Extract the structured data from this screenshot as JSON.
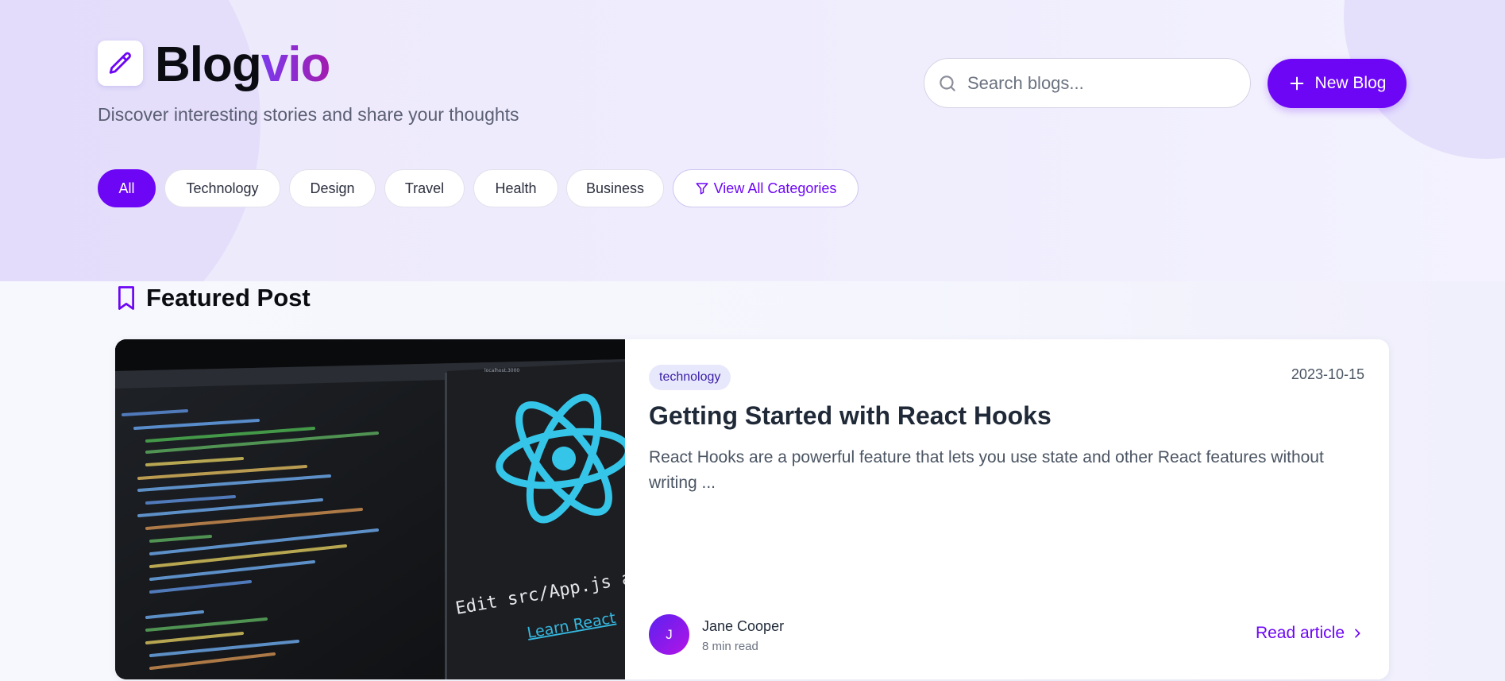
{
  "brand": {
    "name_part1": "Blog",
    "name_part2": "vio",
    "tagline": "Discover interesting stories and share your thoughts",
    "accent_color": "#6d06f5"
  },
  "header": {
    "search_placeholder": "Search blogs...",
    "new_blog_label": "New Blog"
  },
  "categories": {
    "items": [
      "All",
      "Technology",
      "Design",
      "Travel",
      "Health",
      "Business"
    ],
    "active": "All",
    "view_all_label": "View All Categories"
  },
  "featured": {
    "section_title": "Featured Post",
    "post": {
      "category": "technology",
      "date": "2023-10-15",
      "title": "Getting Started with React Hooks",
      "excerpt": "React Hooks are a powerful feature that lets you use state and other React features without writing ...",
      "author_initial": "J",
      "author_name": "Jane Cooper",
      "read_time": "8 min read",
      "read_link_label": "Read article",
      "image": {
        "editor_text": "Edit src/App.js and save to reload.",
        "link_text": "Learn React",
        "url_text": "localhost:3000"
      }
    }
  }
}
